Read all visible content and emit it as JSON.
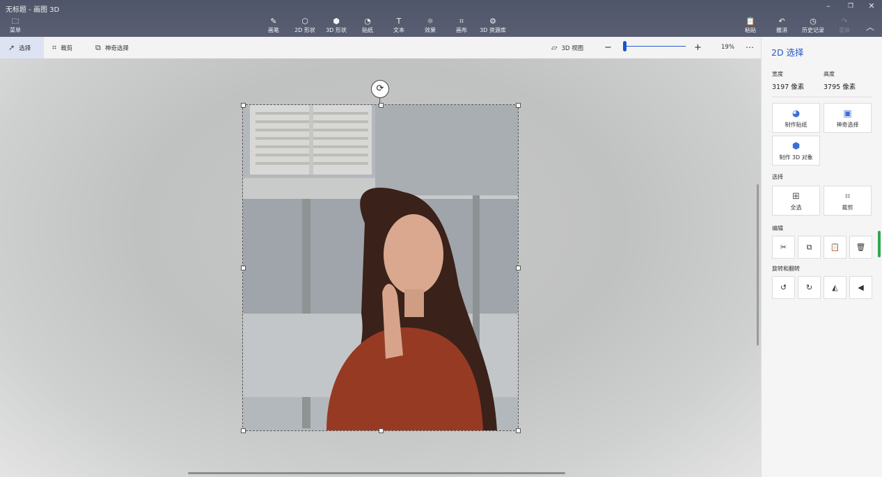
{
  "window": {
    "title": "无标题 - 画图 3D"
  },
  "menu": {
    "label": "菜单"
  },
  "ribbon": [
    {
      "label": "画笔",
      "icon": "brush-icon"
    },
    {
      "label": "2D 形状",
      "icon": "2d-shapes-icon"
    },
    {
      "label": "3D 形状",
      "icon": "3d-shapes-icon"
    },
    {
      "label": "贴纸",
      "icon": "stickers-icon"
    },
    {
      "label": "文本",
      "icon": "text-icon"
    },
    {
      "label": "效果",
      "icon": "effects-icon"
    },
    {
      "label": "画布",
      "icon": "canvas-icon"
    },
    {
      "label": "3D 资源库",
      "icon": "3d-library-icon"
    }
  ],
  "ribbon_right": {
    "paste": "粘贴",
    "undo": "撤消",
    "history": "历史记录",
    "redo": "重做"
  },
  "toolbar": {
    "select": "选择",
    "crop": "裁剪",
    "magic_select": "神奇选择",
    "view3d": "3D 视图",
    "zoom": "19%",
    "zoom_level": 0.03,
    "more": "⋯"
  },
  "panel": {
    "title": "2D 选择",
    "width_label": "宽度",
    "height_label": "高度",
    "width_value": "3197 像素",
    "height_value": "3795 像素",
    "make_sticker": "制作贴纸",
    "magic_select": "神奇选择",
    "make_3d": "制作 3D 对象",
    "select_section": "选择",
    "select_all": "全选",
    "crop": "裁剪",
    "edit_section": "编辑",
    "rotate_section": "旋转和翻转"
  },
  "colors": {
    "accent": "#2159c6",
    "titlebar": "#545a6e",
    "active_tool_bg": "#dde3f3"
  }
}
